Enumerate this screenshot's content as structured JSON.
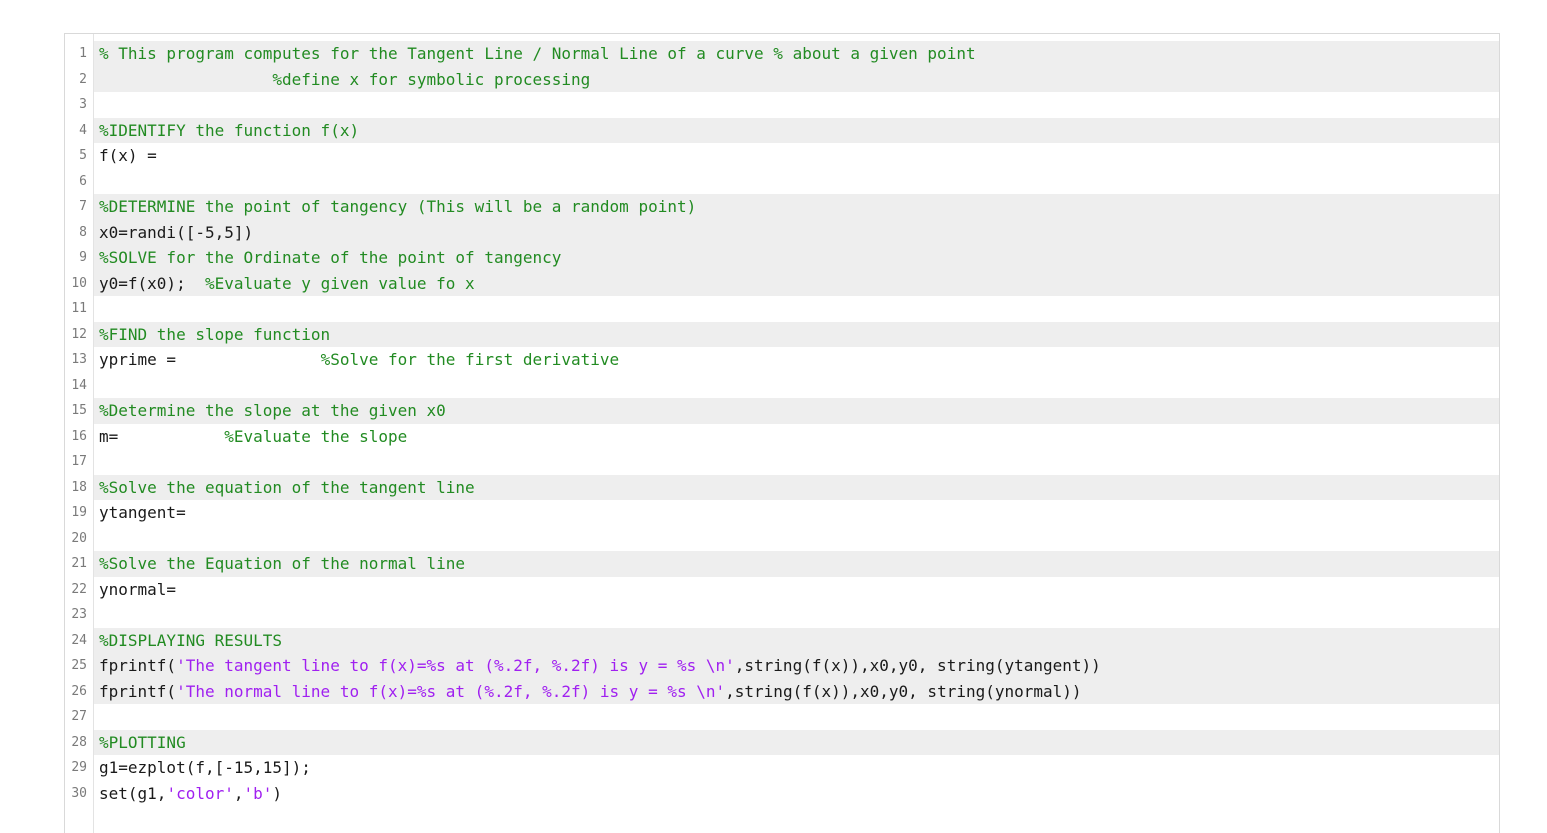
{
  "editor": {
    "lines": [
      {
        "num": "1",
        "tokens": [
          {
            "t": "c",
            "v": "% This program computes for the Tangent Line / Normal Line of a curve % about a given point"
          }
        ]
      },
      {
        "num": "2",
        "tokens": [
          {
            "t": "p",
            "v": "                  "
          },
          {
            "t": "c",
            "v": "%define x for symbolic processing"
          }
        ]
      },
      {
        "num": "3",
        "tokens": []
      },
      {
        "num": "4",
        "tokens": [
          {
            "t": "c",
            "v": "%IDENTIFY the function f(x)"
          }
        ]
      },
      {
        "num": "5",
        "tokens": [
          {
            "t": "p",
            "v": "f(x) ="
          }
        ]
      },
      {
        "num": "6",
        "tokens": []
      },
      {
        "num": "7",
        "tokens": [
          {
            "t": "c",
            "v": "%DETERMINE the point of tangency (This will be a random point)"
          }
        ]
      },
      {
        "num": "8",
        "tokens": [
          {
            "t": "p",
            "v": "x0=randi([-5,5])"
          }
        ]
      },
      {
        "num": "9",
        "tokens": [
          {
            "t": "c",
            "v": "%SOLVE for the Ordinate of the point of tangency"
          }
        ]
      },
      {
        "num": "10",
        "tokens": [
          {
            "t": "p",
            "v": "y0=f(x0);  "
          },
          {
            "t": "c",
            "v": "%Evaluate y given value fo x"
          }
        ]
      },
      {
        "num": "11",
        "tokens": []
      },
      {
        "num": "12",
        "tokens": [
          {
            "t": "c",
            "v": "%FIND the slope function"
          }
        ]
      },
      {
        "num": "13",
        "tokens": [
          {
            "t": "p",
            "v": "yprime =               "
          },
          {
            "t": "c",
            "v": "%Solve for the first derivative"
          }
        ]
      },
      {
        "num": "14",
        "tokens": []
      },
      {
        "num": "15",
        "tokens": [
          {
            "t": "c",
            "v": "%Determine the slope at the given x0"
          }
        ]
      },
      {
        "num": "16",
        "tokens": [
          {
            "t": "p",
            "v": "m=           "
          },
          {
            "t": "c",
            "v": "%Evaluate the slope"
          }
        ]
      },
      {
        "num": "17",
        "tokens": []
      },
      {
        "num": "18",
        "tokens": [
          {
            "t": "c",
            "v": "%Solve the equation of the tangent line"
          }
        ]
      },
      {
        "num": "19",
        "tokens": [
          {
            "t": "p",
            "v": "ytangent="
          }
        ]
      },
      {
        "num": "20",
        "tokens": []
      },
      {
        "num": "21",
        "tokens": [
          {
            "t": "c",
            "v": "%Solve the Equation of the normal line"
          }
        ]
      },
      {
        "num": "22",
        "tokens": [
          {
            "t": "p",
            "v": "ynormal="
          }
        ]
      },
      {
        "num": "23",
        "tokens": []
      },
      {
        "num": "24",
        "tokens": [
          {
            "t": "c",
            "v": "%DISPLAYING RESULTS"
          }
        ]
      },
      {
        "num": "25",
        "tokens": [
          {
            "t": "p",
            "v": "fprintf("
          },
          {
            "t": "s",
            "v": "'The tangent line to f(x)=%s at (%.2f, %.2f) is y = %s \\n'"
          },
          {
            "t": "p",
            "v": ",string(f(x)),x0,y0, string(ytangent))"
          }
        ]
      },
      {
        "num": "26",
        "tokens": [
          {
            "t": "p",
            "v": "fprintf("
          },
          {
            "t": "s",
            "v": "'The normal line to f(x)=%s at (%.2f, %.2f) is y = %s \\n'"
          },
          {
            "t": "p",
            "v": ",string(f(x)),x0,y0, string(ynormal))"
          }
        ]
      },
      {
        "num": "27",
        "tokens": []
      },
      {
        "num": "28",
        "tokens": [
          {
            "t": "c",
            "v": "%PLOTTING"
          }
        ]
      },
      {
        "num": "29",
        "tokens": [
          {
            "t": "p",
            "v": "g1=ezplot(f,[-15,15]);"
          }
        ]
      },
      {
        "num": "30",
        "tokens": [
          {
            "t": "p",
            "v": "set(g1,"
          },
          {
            "t": "s",
            "v": "'color'"
          },
          {
            "t": "p",
            "v": ","
          },
          {
            "t": "s",
            "v": "'b'"
          },
          {
            "t": "p",
            "v": ")"
          }
        ]
      }
    ]
  },
  "colors": {
    "comment": "#228b22",
    "string": "#a020f0",
    "plain": "#1a1a1a",
    "line_number": "#7a7a7a",
    "alt_row": "#eeeeee"
  }
}
